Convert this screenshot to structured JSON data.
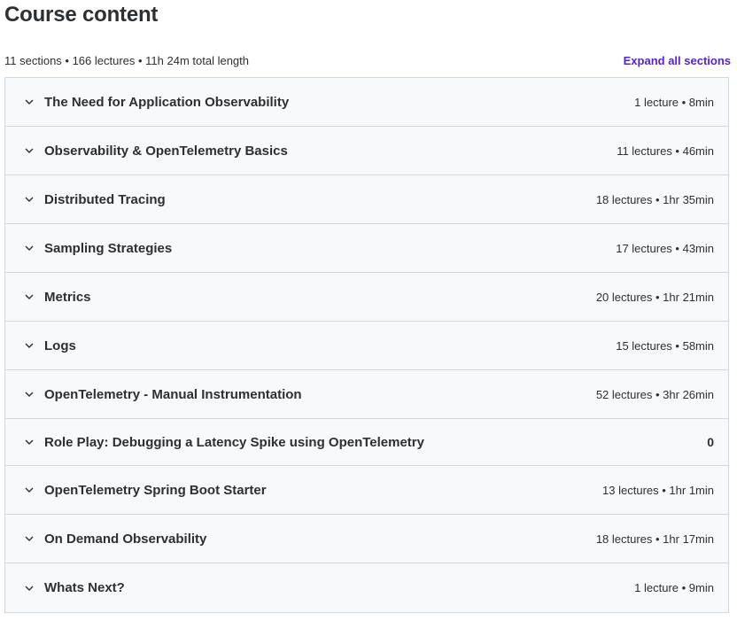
{
  "header": {
    "title": "Course content",
    "summary": "11 sections • 166 lectures • 11h 24m total length",
    "expand_all_label": "Expand all sections",
    "accent_color": "#5624d0"
  },
  "sections": [
    {
      "title": "The Need for Application Observability",
      "meta": "1 lecture • 8min"
    },
    {
      "title": "Observability & OpenTelemetry Basics",
      "meta": "11 lectures • 46min"
    },
    {
      "title": "Distributed Tracing",
      "meta": "18 lectures • 1hr 35min"
    },
    {
      "title": "Sampling Strategies",
      "meta": "17 lectures • 43min"
    },
    {
      "title": "Metrics",
      "meta": "20 lectures • 1hr 21min"
    },
    {
      "title": "Logs",
      "meta": "15 lectures • 58min"
    },
    {
      "title": "OpenTelemetry - Manual Instrumentation",
      "meta": "52 lectures • 3hr 26min"
    },
    {
      "title": "Role Play: Debugging a Latency Spike using OpenTelemetry",
      "meta": "0"
    },
    {
      "title": "OpenTelemetry Spring Boot Starter",
      "meta": "13 lectures • 1hr 1min"
    },
    {
      "title": "On Demand Observability",
      "meta": "18 lectures • 1hr 17min"
    },
    {
      "title": "Whats Next?",
      "meta": "1 lecture • 9min"
    }
  ],
  "icons": {
    "section_toggle": "chevron-down-icon"
  }
}
